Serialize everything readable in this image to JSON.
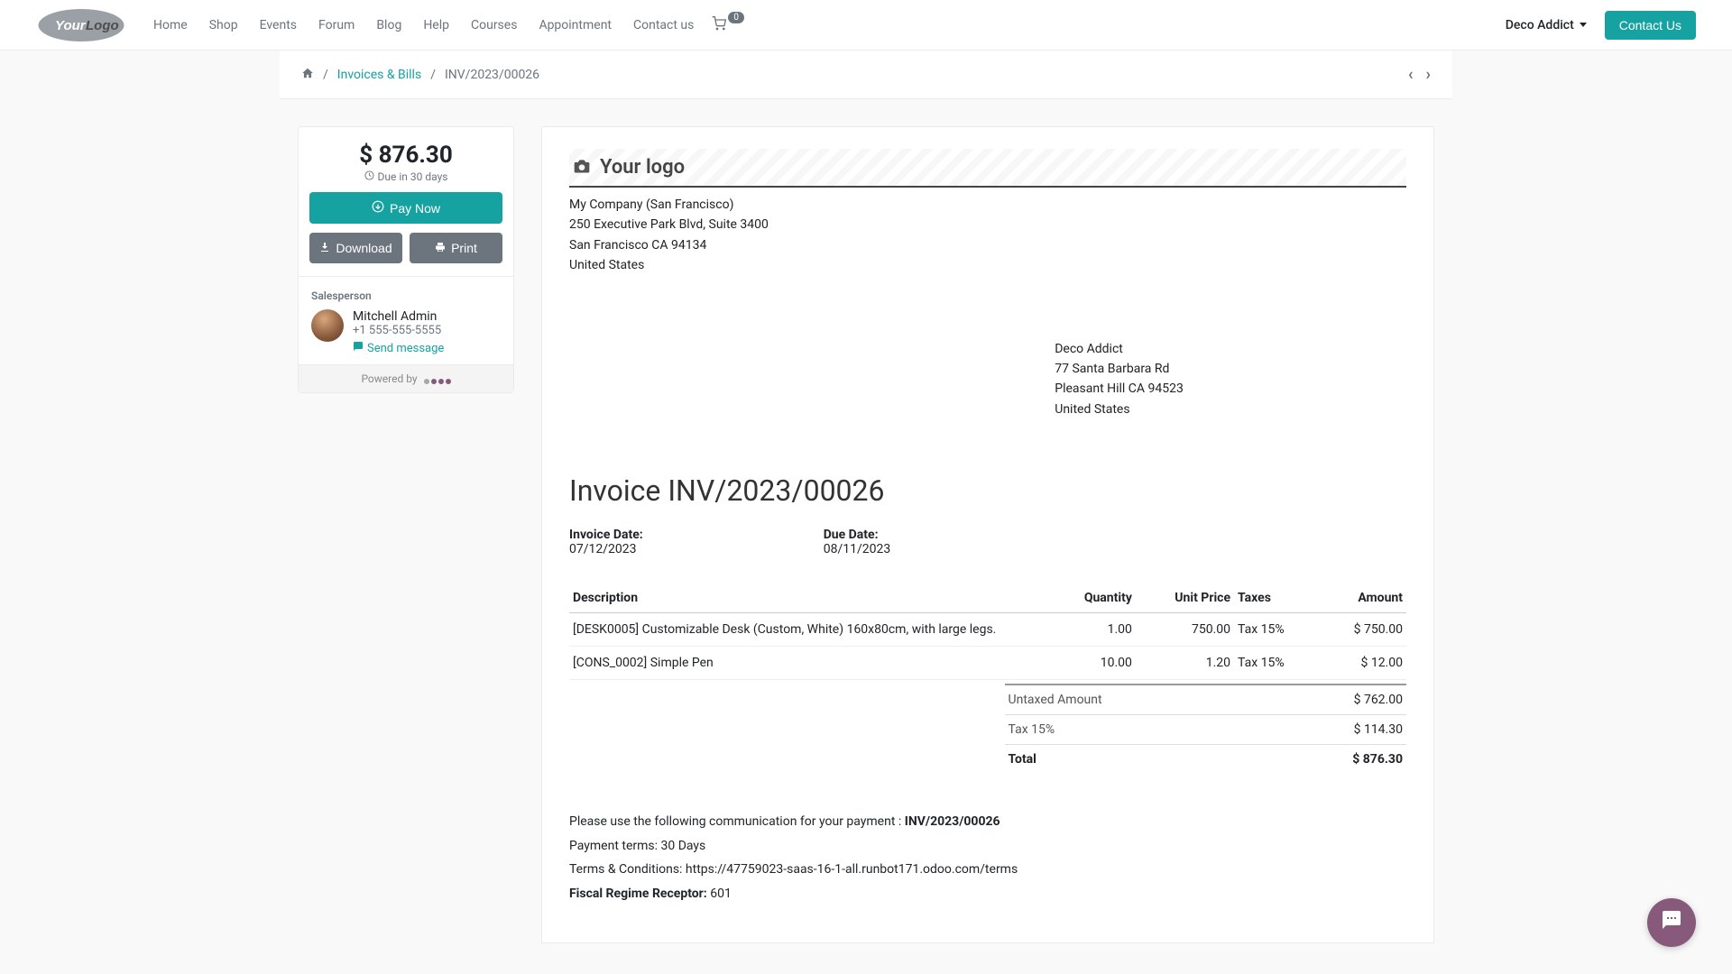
{
  "nav": {
    "items": [
      "Home",
      "Shop",
      "Events",
      "Forum",
      "Blog",
      "Help",
      "Courses",
      "Appointment",
      "Contact us"
    ],
    "cart_count": "0",
    "user": "Deco Addict",
    "contact_btn": "Contact Us"
  },
  "breadcrumb": {
    "link": "Invoices & Bills",
    "current": "INV/2023/00026"
  },
  "sidebar": {
    "amount": "$ 876.30",
    "due_text": "Due in 30 days",
    "pay_now": "Pay Now",
    "download": "Download",
    "print": "Print",
    "salesperson_label": "Salesperson",
    "sp_name": "Mitchell Admin",
    "sp_phone": "+1 555-555-5555",
    "send_message": "Send message",
    "powered_by": "Powered by"
  },
  "doc": {
    "logo_text": "Your logo",
    "company": {
      "name": "My Company (San Francisco)",
      "street": "250 Executive Park Blvd, Suite 3400",
      "city": "San Francisco CA 94134",
      "country": "United States"
    },
    "customer": {
      "name": "Deco Addict",
      "street": "77 Santa Barbara Rd",
      "city": "Pleasant Hill CA 94523",
      "country": "United States"
    },
    "title": "Invoice INV/2023/00026",
    "inv_date_label": "Invoice Date:",
    "inv_date": "07/12/2023",
    "due_date_label": "Due Date:",
    "due_date": "08/11/2023",
    "columns": {
      "description": "Description",
      "quantity": "Quantity",
      "unit_price": "Unit Price",
      "taxes": "Taxes",
      "amount": "Amount"
    },
    "lines": [
      {
        "desc": "[DESK0005] Customizable Desk (Custom, White) 160x80cm, with large legs.",
        "qty": "1.00",
        "price": "750.00",
        "tax": "Tax 15%",
        "amount": "$ 750.00"
      },
      {
        "desc": "[CONS_0002] Simple Pen",
        "qty": "10.00",
        "price": "1.20",
        "tax": "Tax 15%",
        "amount": "$ 12.00"
      }
    ],
    "totals": {
      "untaxed_label": "Untaxed Amount",
      "untaxed": "$ 762.00",
      "tax_label": "Tax 15%",
      "tax": "$ 114.30",
      "total_label": "Total",
      "total": "$ 876.30"
    },
    "note_payment_prefix": "Please use the following communication for your payment : ",
    "note_payment_ref": "INV/2023/00026",
    "note_terms": "Payment terms: 30 Days",
    "note_tandc": "Terms & Conditions: https://47759023-saas-16-1-all.runbot171.odoo.com/terms",
    "note_fiscal_label": "Fiscal Regime Receptor: ",
    "note_fiscal_val": "601"
  }
}
